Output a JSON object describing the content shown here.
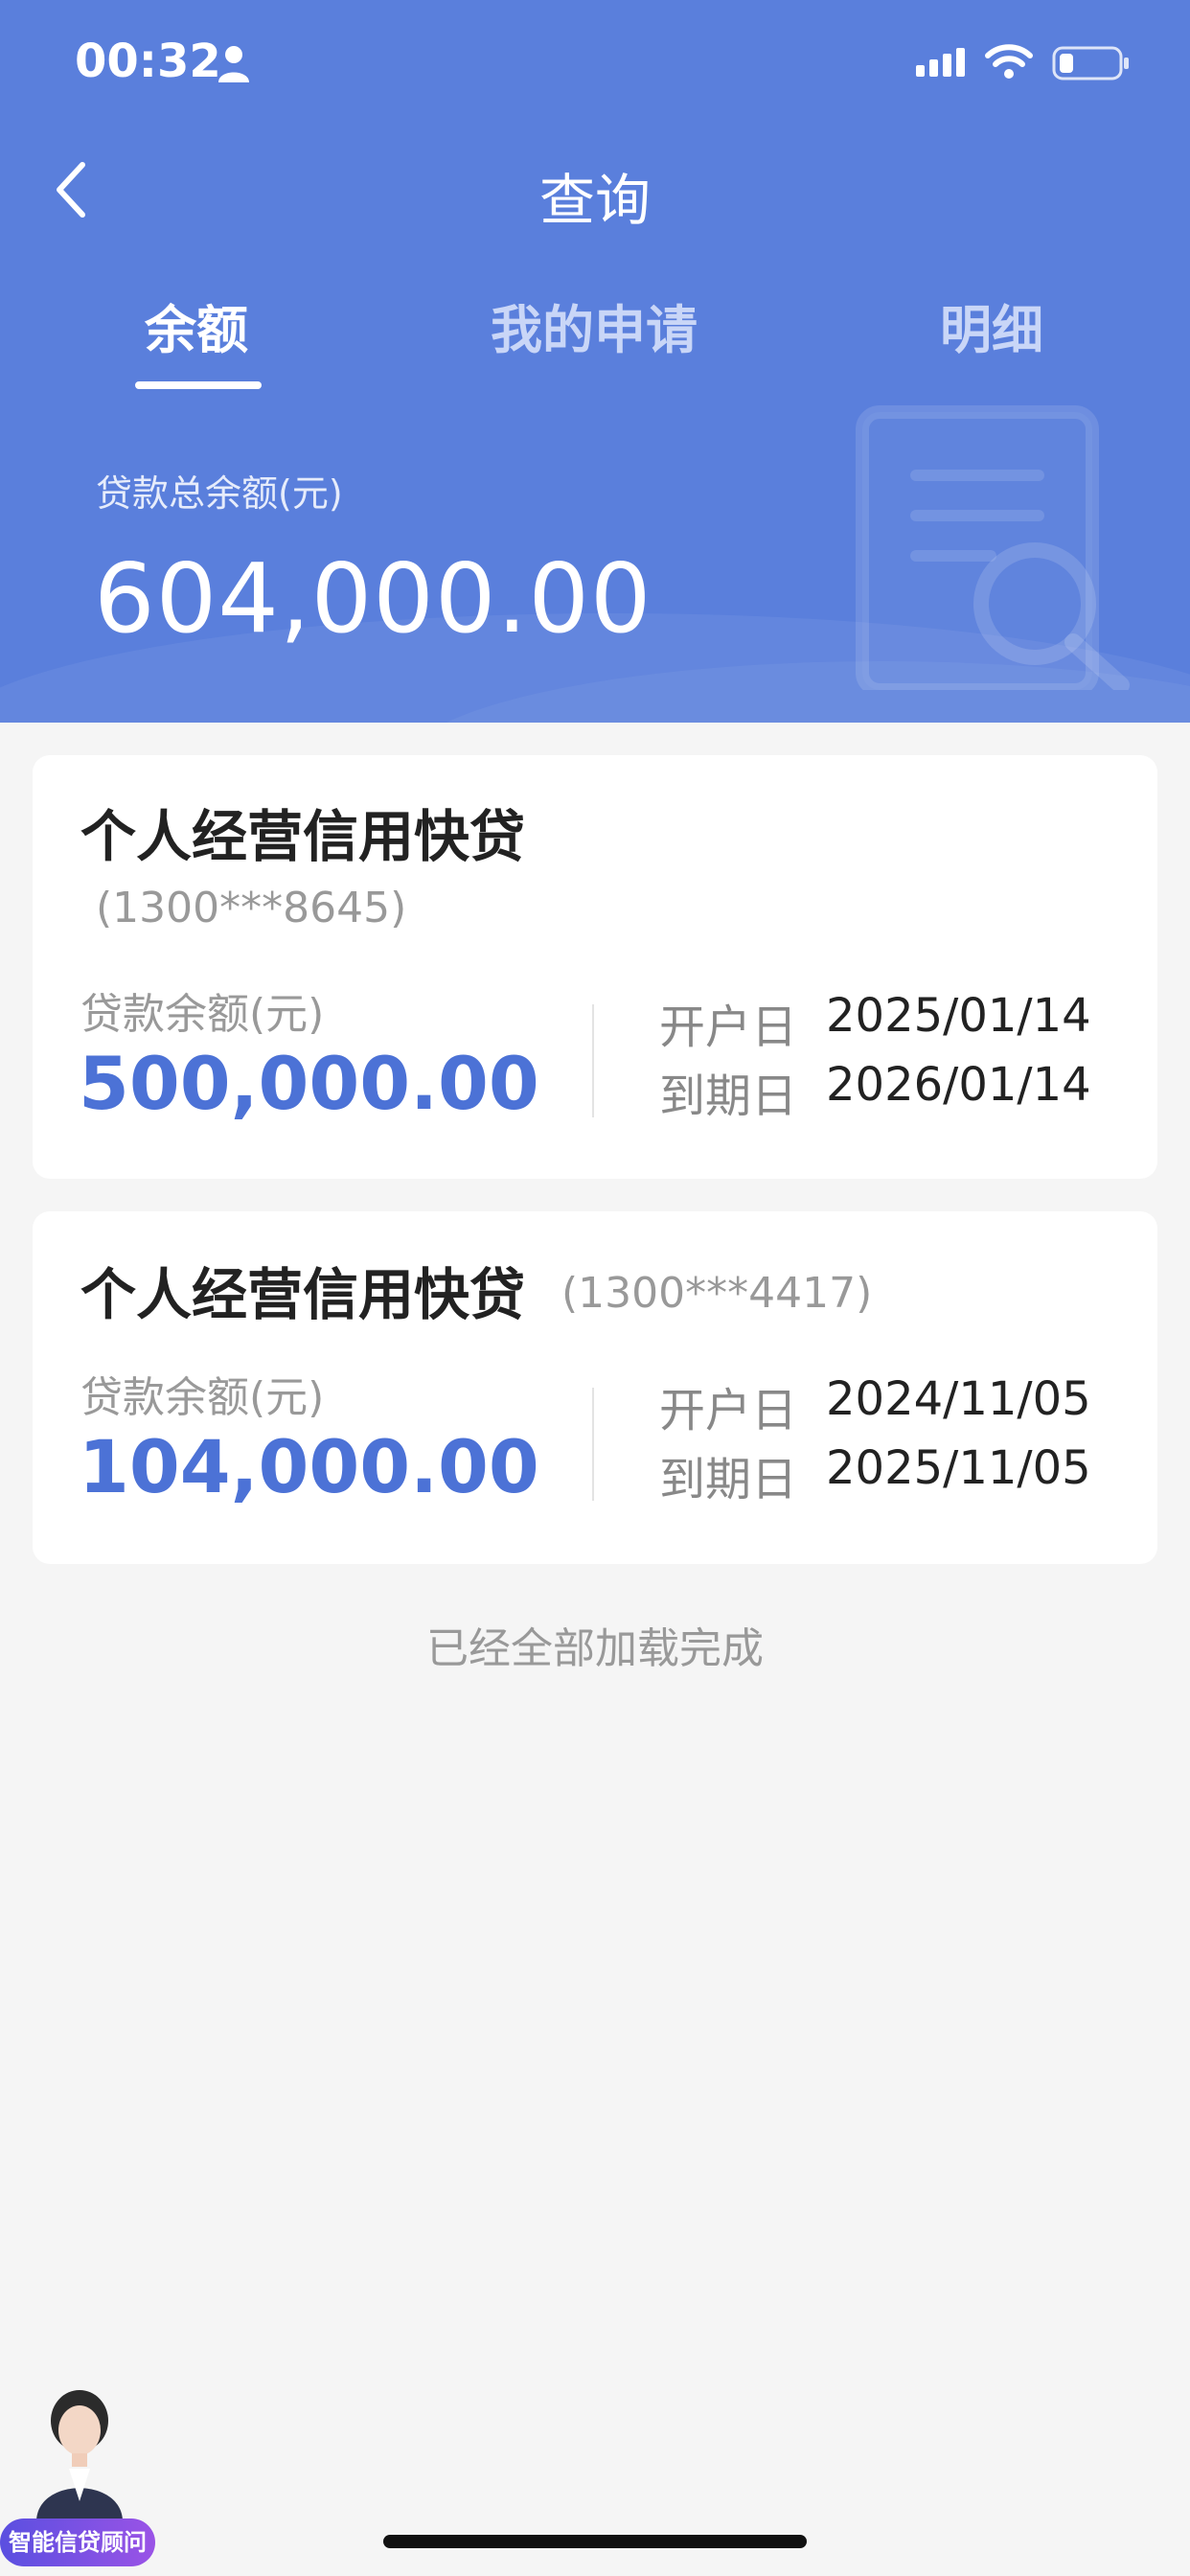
{
  "status_bar": {
    "time": "00:32"
  },
  "nav": {
    "title": "查询"
  },
  "tabs": [
    {
      "label": "余额",
      "active": true
    },
    {
      "label": "我的申请",
      "active": false
    },
    {
      "label": "明细",
      "active": false
    }
  ],
  "summary": {
    "total_label": "贷款总余额(元)",
    "total_value": "604,000.00"
  },
  "loans": [
    {
      "name": "个人经营信用快贷",
      "account": "(1300***8645)",
      "balance_label": "贷款余额(元)",
      "balance_value": "500,000.00",
      "open_label": "开户日",
      "open_date": "2025/01/14",
      "due_label": "到期日",
      "due_date": "2026/01/14"
    },
    {
      "name": "个人经营信用快贷",
      "account": "(1300***4417)",
      "balance_label": "贷款余额(元)",
      "balance_value": "104,000.00",
      "open_label": "开户日",
      "open_date": "2024/11/05",
      "due_label": "到期日",
      "due_date": "2025/11/05"
    }
  ],
  "footer": {
    "load_complete": "已经全部加载完成"
  },
  "assistant": {
    "label": "智能信贷顾问"
  },
  "colors": {
    "header_bg": "#5a7fdc",
    "accent": "#4c72d6",
    "page_bg": "#f5f5f5"
  }
}
